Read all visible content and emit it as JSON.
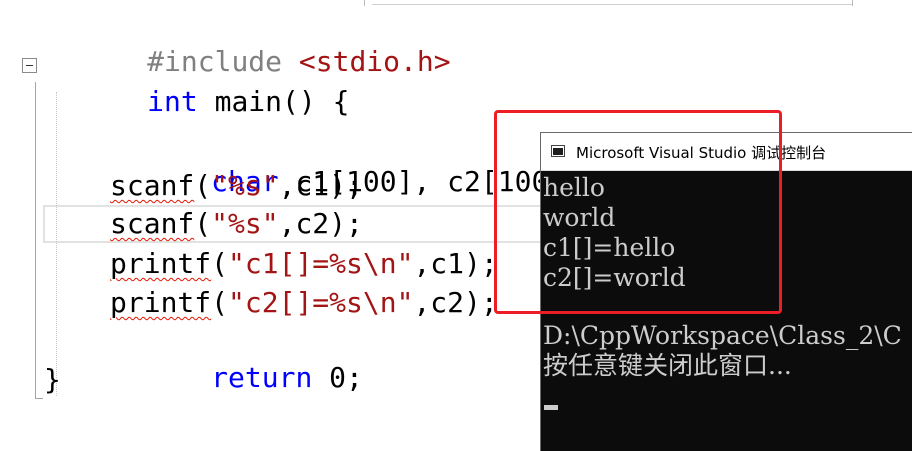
{
  "editor": {
    "lines": {
      "include": {
        "directive": "#include",
        "header": "<stdio.h>"
      },
      "main_sig": {
        "type": "int",
        "rest": "main() {"
      },
      "decl": {
        "type": "char",
        "rest": "c1[100], c2[100];"
      },
      "scanf1": {
        "fn": "scanf",
        "open": "(",
        "fmt": "\"%s\"",
        "rest": ",c1);"
      },
      "scanf2": {
        "fn": "scanf",
        "open": "(",
        "fmt": "\"%s\"",
        "rest": ",c2);"
      },
      "printf1": {
        "fn": "printf",
        "open": "(",
        "fmt": "\"c1[]=%s\\n\"",
        "rest": ",c1);"
      },
      "printf2": {
        "fn": "printf",
        "open": "(",
        "fmt": "\"c2[]=%s\\n\"",
        "rest": ",c2);"
      },
      "ret": {
        "kw": "return",
        "rest": "0;"
      },
      "close": "}"
    },
    "colors": {
      "keyword": "#0000ff",
      "string": "#a31515",
      "preprocessor": "#808080",
      "squiggle": "#e51400"
    }
  },
  "console": {
    "title": "Microsoft Visual Studio 调试控制台",
    "icon": "console-window-icon",
    "output": [
      "hello",
      "world",
      "c1[]=hello",
      "c2[]=world"
    ],
    "path_line": "D:\\CppWorkspace\\Class_2\\C",
    "prompt_line": "按任意键关闭此窗口...",
    "background": "#0c0c0c",
    "text_color": "#cccccc"
  },
  "annotation": {
    "color": "#ee1c25"
  }
}
